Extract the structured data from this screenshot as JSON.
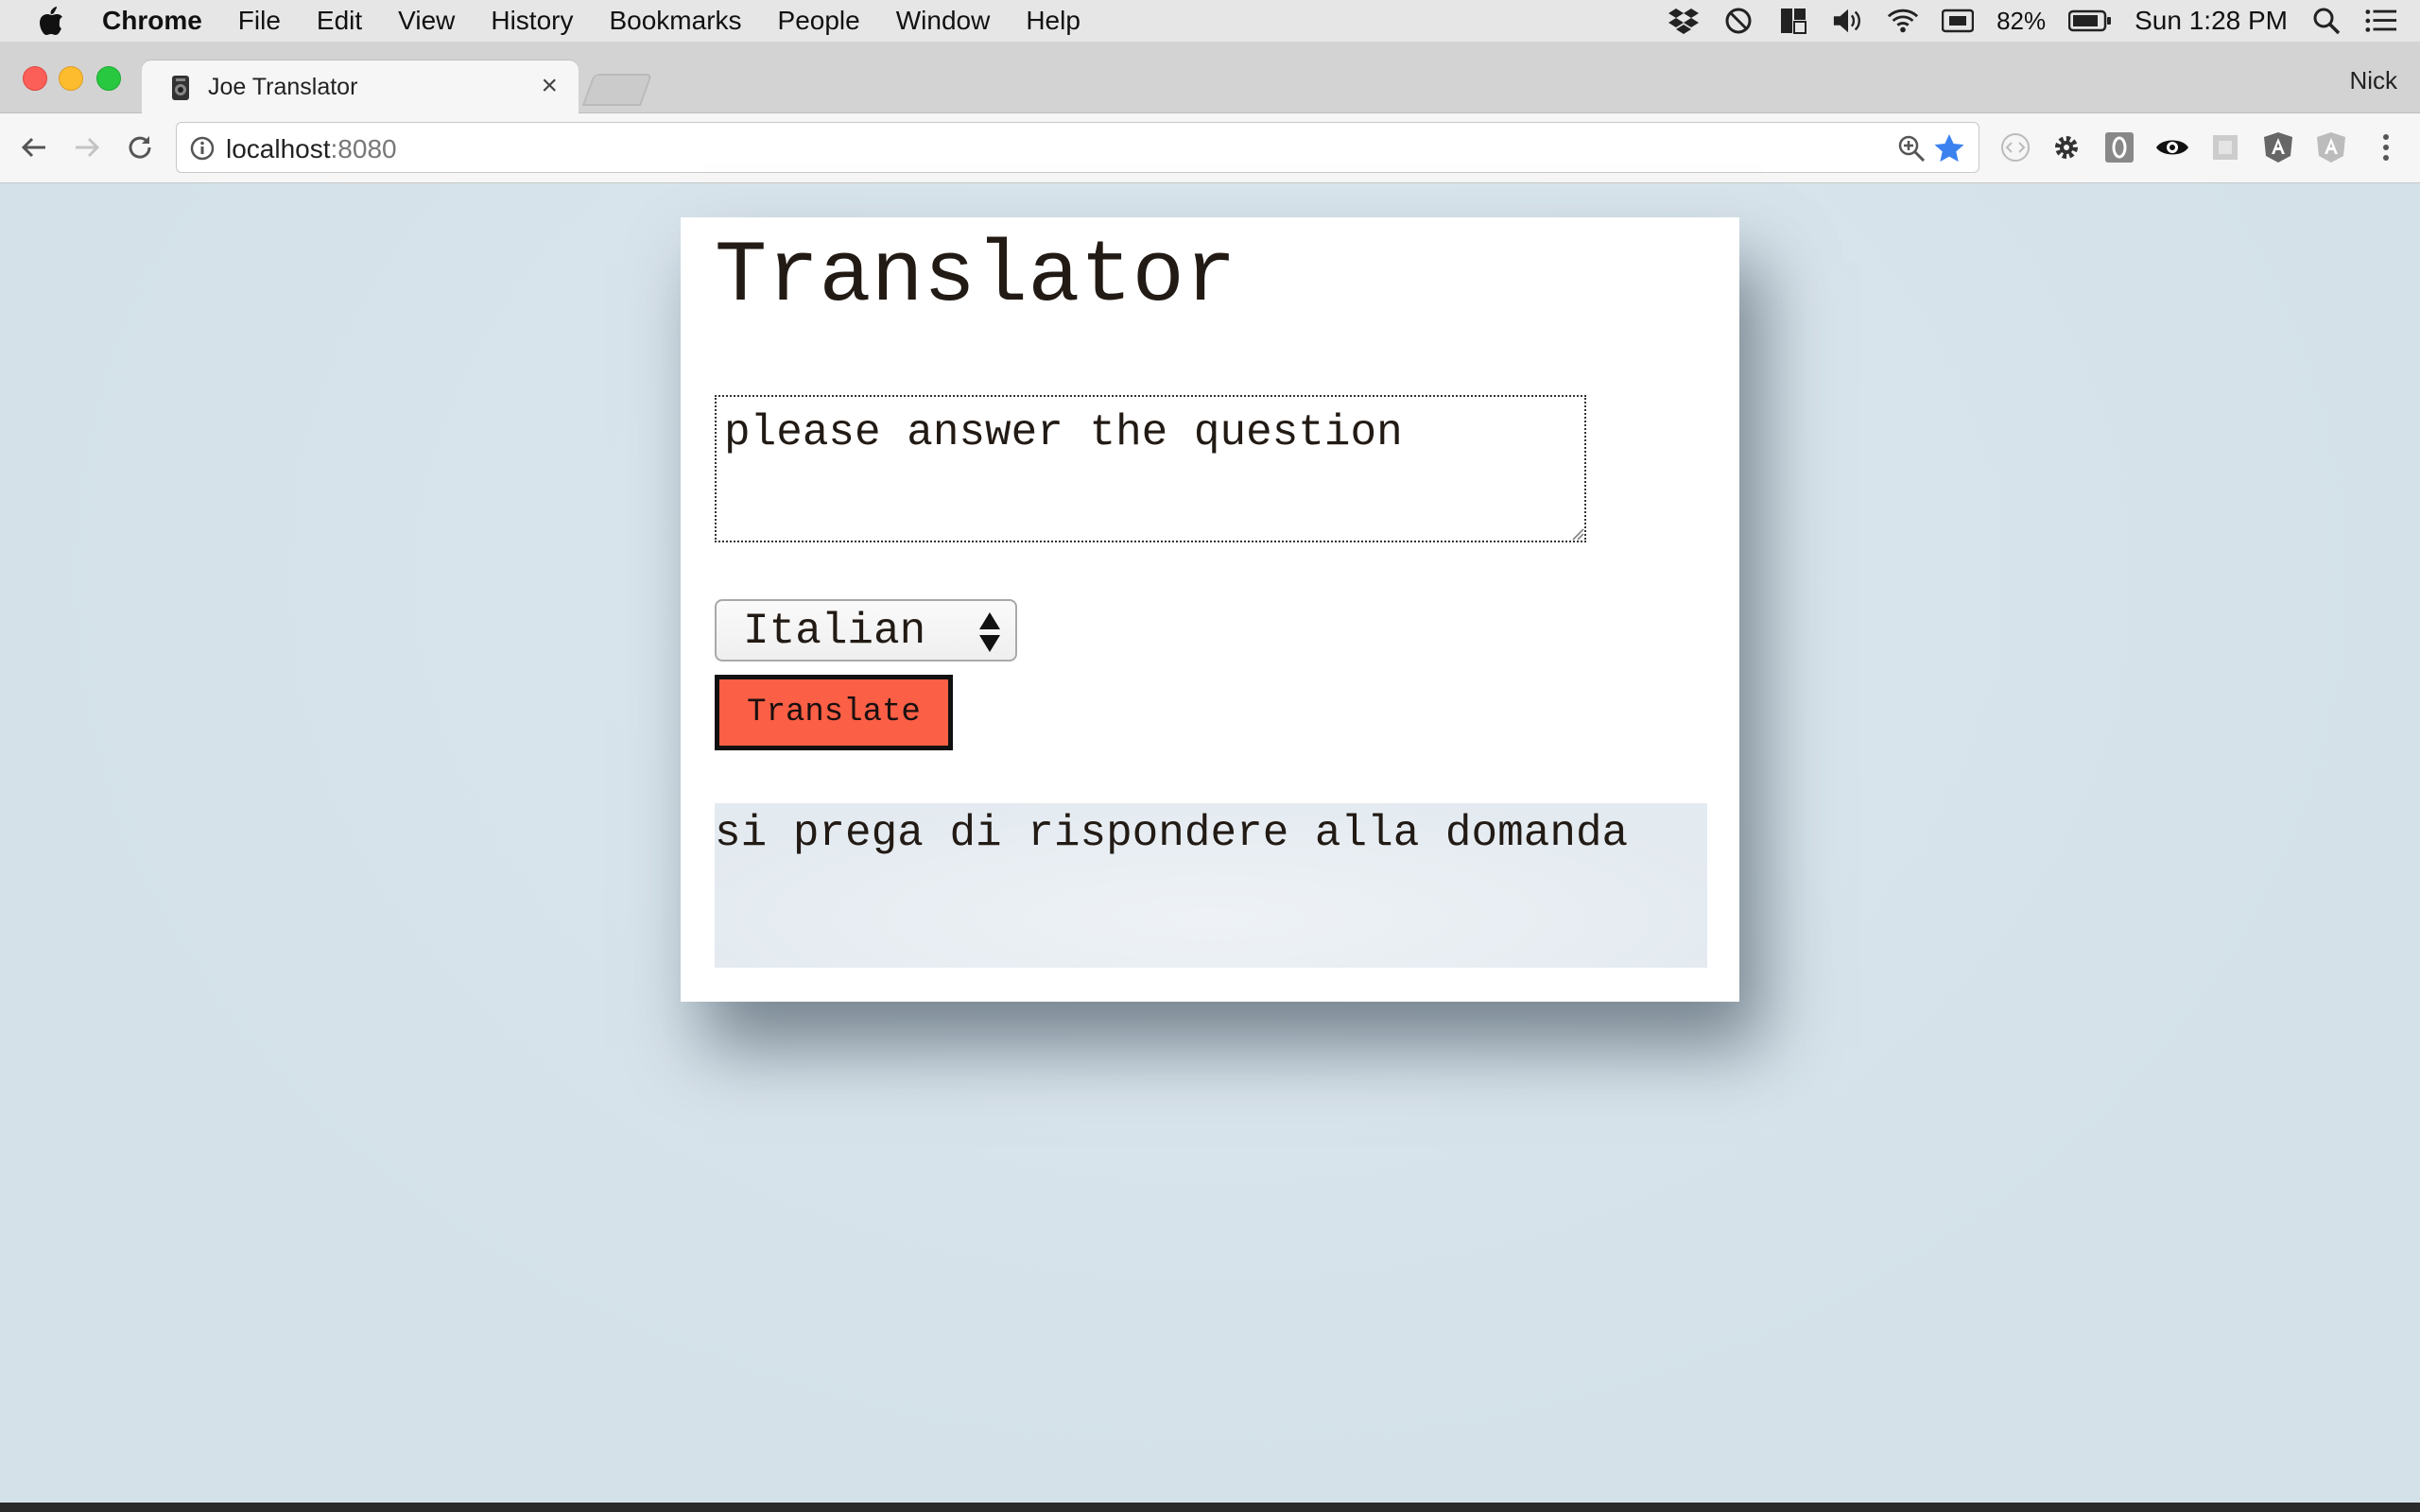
{
  "menubar": {
    "app_name": "Chrome",
    "items": [
      "File",
      "Edit",
      "View",
      "History",
      "Bookmarks",
      "People",
      "Window",
      "Help"
    ],
    "battery": "82%",
    "clock": "Sun 1:28 PM"
  },
  "browser": {
    "tab_title": "Joe Translator",
    "tab_close": "×",
    "profile_name": "Nick",
    "url_host": "localhost",
    "url_port": ":8080"
  },
  "page": {
    "title": "Translator",
    "source_text": "please answer the question",
    "language_selected": "Italian",
    "translate_label": "Translate",
    "result_text": "si prega di rispondere alla domanda"
  },
  "colors": {
    "page_background": "#d5e2ea",
    "translate_button": "#fb5f45"
  }
}
